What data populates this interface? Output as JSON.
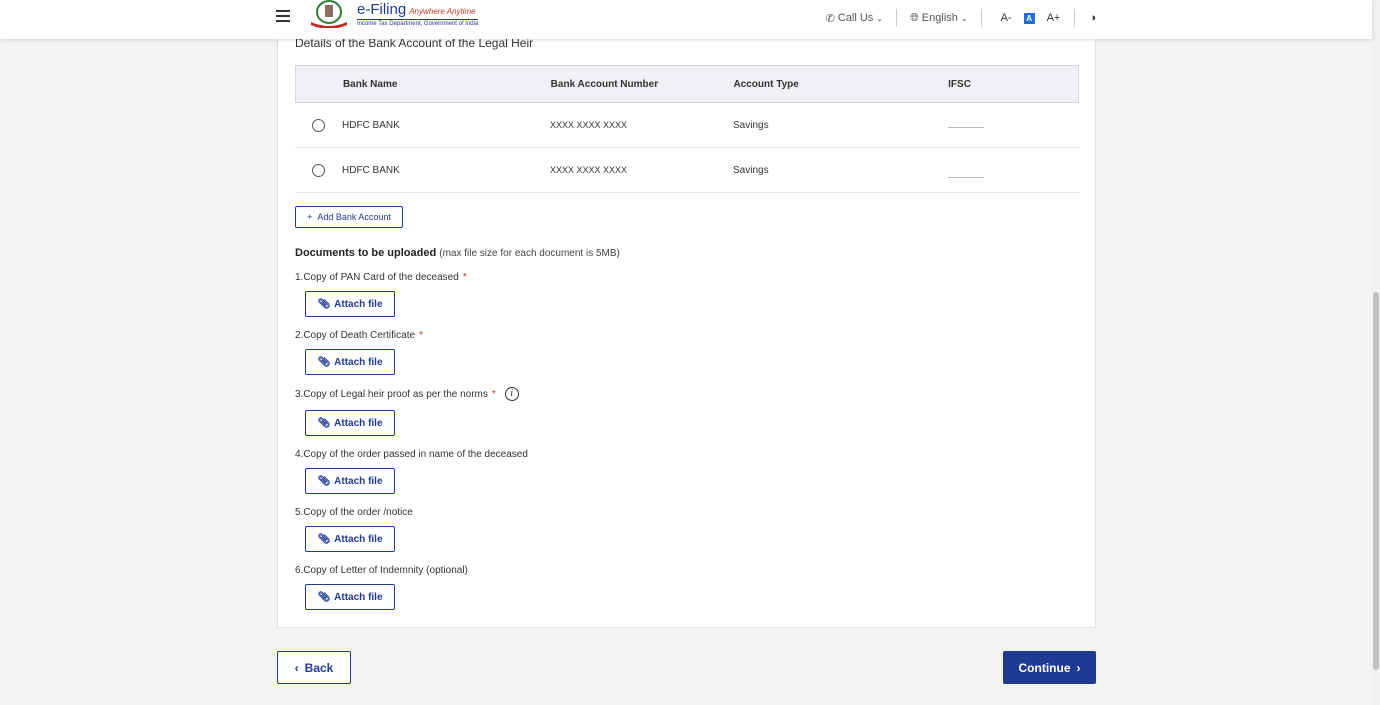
{
  "header": {
    "logo_title": "e-Filing",
    "logo_tagline": "Anywhere Anytime",
    "logo_subtitle": "Income Tax Department, Government of India",
    "call_us": "Call Us",
    "language": "English",
    "font_decrease": "A-",
    "font_normal": "A",
    "font_increase": "A+"
  },
  "bank_section": {
    "title": "Details of the Bank Account of the Legal Heir",
    "columns": [
      "Bank Name",
      "Bank Account Number",
      "Account Type",
      "IFSC"
    ],
    "rows": [
      {
        "bank_name": "HDFC BANK",
        "account_number": "XXXX XXXX XXXX",
        "account_type": "Savings",
        "ifsc": ""
      },
      {
        "bank_name": "HDFC BANK",
        "account_number": "XXXX XXXX XXXX",
        "account_type": "Savings",
        "ifsc": ""
      }
    ],
    "add_button": "Add Bank Account"
  },
  "documents": {
    "title": "Documents to be uploaded",
    "note": "(max file size for each document is 5MB)",
    "items": [
      {
        "label": "1.Copy of PAN Card of the deceased",
        "required": "*"
      },
      {
        "label": "2.Copy of Death Certificate",
        "required": "*"
      },
      {
        "label": "3.Copy of Legal heir proof as per the norms",
        "required": "*"
      },
      {
        "label": "4.Copy of the order passed in name of the deceased",
        "required": ""
      },
      {
        "label": "5.Copy of the order /notice",
        "required": ""
      },
      {
        "label": "6.Copy of Letter of Indemnity (optional)",
        "required": ""
      }
    ],
    "attach_label": "Attach file"
  },
  "footer": {
    "back": "Back",
    "continue": "Continue"
  },
  "colors": {
    "primary": "#1f3a93",
    "required": "#c0392b",
    "background": "#f2f3f5"
  }
}
